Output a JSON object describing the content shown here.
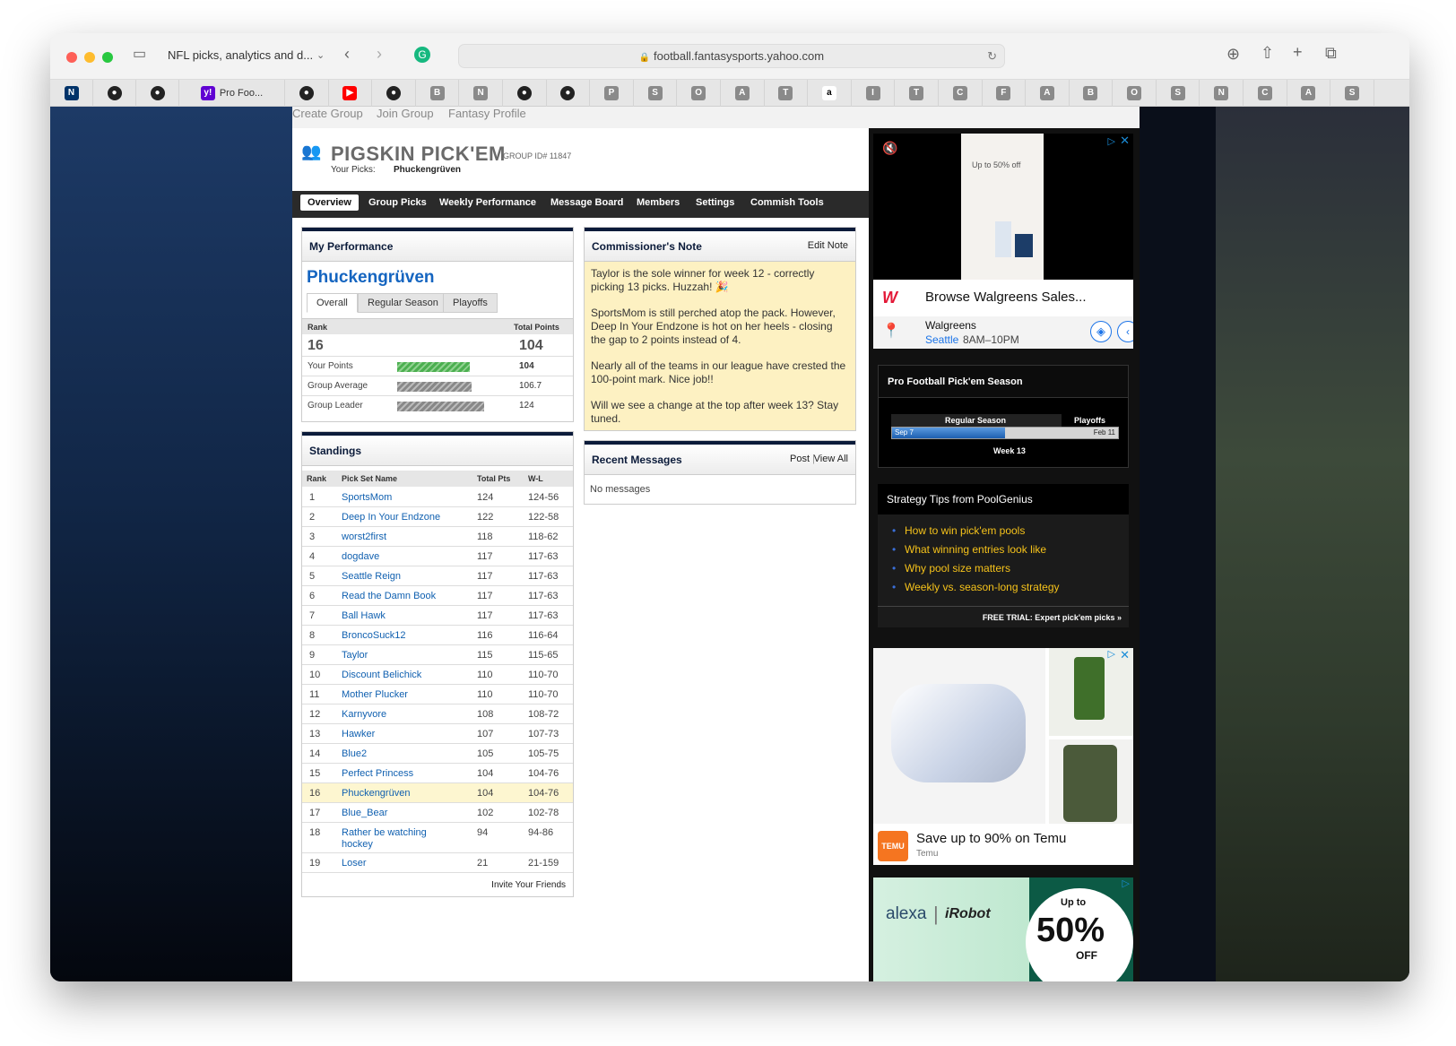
{
  "browser": {
    "tab_title": "NFL picks, analytics and d...",
    "url": "football.fantasysports.yahoo.com"
  },
  "favorites": [
    {
      "icon": "nfl-icon",
      "label": ""
    },
    {
      "icon": "github-icon",
      "label": ""
    },
    {
      "icon": "github-icon",
      "label": ""
    },
    {
      "icon": "yahoo-icon",
      "label": "Pro Foo..."
    },
    {
      "icon": "github-icon",
      "label": ""
    },
    {
      "icon": "youtube-icon",
      "label": ""
    },
    {
      "icon": "github-icon",
      "label": ""
    },
    {
      "letter": "B"
    },
    {
      "letter": "N"
    },
    {
      "icon": "medium-icon",
      "label": ""
    },
    {
      "icon": "medium-icon",
      "label": ""
    },
    {
      "letter": "P"
    },
    {
      "letter": "S"
    },
    {
      "letter": "O"
    },
    {
      "letter": "A"
    },
    {
      "letter": "T"
    },
    {
      "icon": "amazon-icon",
      "label": "a"
    },
    {
      "letter": "I"
    },
    {
      "letter": "T"
    },
    {
      "letter": "C"
    },
    {
      "letter": "F"
    },
    {
      "letter": "A"
    },
    {
      "letter": "B"
    },
    {
      "letter": "O"
    },
    {
      "letter": "S"
    },
    {
      "letter": "N"
    },
    {
      "letter": "C"
    },
    {
      "letter": "A"
    },
    {
      "letter": "S"
    }
  ],
  "toplinks": [
    "Create Group",
    "Join Group",
    "Fantasy Profile"
  ],
  "header": {
    "title": "PIGSKIN PICK'EM",
    "group_id": "GROUP ID# 11847",
    "your_picks_label": "Your Picks:",
    "your_picks_name": "Phuckengrüven"
  },
  "nav": [
    "Overview",
    "Group Picks",
    "Weekly Performance",
    "Message Board",
    "Members",
    "Settings",
    "Commish Tools"
  ],
  "performance": {
    "title": "My Performance",
    "name": "Phuckengrüven",
    "tabs": [
      "Overall",
      "Regular Season",
      "Playoffs"
    ],
    "rank_label": "Rank",
    "total_label": "Total Points",
    "rank": "16",
    "total": "104",
    "rows": [
      {
        "label": "Your Points",
        "value": "104",
        "fill": 0.81
      },
      {
        "label": "Group Average",
        "value": "106.7",
        "fill": 0.83
      },
      {
        "label": "Group Leader",
        "value": "124",
        "fill": 0.97
      }
    ]
  },
  "standings": {
    "title": "Standings",
    "headers": [
      "Rank",
      "Pick Set Name",
      "Total Pts",
      "W-L"
    ],
    "rows": [
      [
        "1",
        "SportsMom",
        "124",
        "124-56"
      ],
      [
        "2",
        "Deep In Your Endzone",
        "122",
        "122-58"
      ],
      [
        "3",
        "worst2first",
        "118",
        "118-62"
      ],
      [
        "4",
        "dogdave",
        "117",
        "117-63"
      ],
      [
        "5",
        "Seattle Reign",
        "117",
        "117-63"
      ],
      [
        "6",
        "Read the Damn Book",
        "117",
        "117-63"
      ],
      [
        "7",
        "Ball Hawk",
        "117",
        "117-63"
      ],
      [
        "8",
        "BroncoSuck12",
        "116",
        "116-64"
      ],
      [
        "9",
        "Taylor",
        "115",
        "115-65"
      ],
      [
        "10",
        "Discount Belichick",
        "110",
        "110-70"
      ],
      [
        "11",
        "Mother Plucker",
        "110",
        "110-70"
      ],
      [
        "12",
        "Karnyvore",
        "108",
        "108-72"
      ],
      [
        "13",
        "Hawker",
        "107",
        "107-73"
      ],
      [
        "14",
        "Blue2",
        "105",
        "105-75"
      ],
      [
        "15",
        "Perfect Princess",
        "104",
        "104-76"
      ],
      [
        "16",
        "Phuckengrüven",
        "104",
        "104-76"
      ],
      [
        "17",
        "Blue_Bear",
        "102",
        "102-78"
      ],
      [
        "18",
        "Rather be watching",
        "94",
        "94-86"
      ],
      [
        "19",
        "Loser",
        "21",
        "21-159"
      ]
    ],
    "row18_line2": "hockey",
    "invite": "Invite Your Friends"
  },
  "commish": {
    "title": "Commissioner's Note",
    "edit": "Edit Note",
    "paras": [
      "Taylor is the sole winner for week 12 - correctly picking 13 picks. Huzzah! 🎉",
      "SportsMom is still perched atop the pack. However, Deep In Your Endzone is hot on her heels - closing the gap to 2 points instead of 4.",
      "Nearly all of the teams in our league have crested the 100-point mark. Nice job!!",
      "Will we see a change at the top after week 13? Stay tuned."
    ]
  },
  "messages": {
    "title": "Recent Messages",
    "post": "Post",
    "view_all": "View All",
    "empty": "No messages"
  },
  "ad_walgreens": {
    "promo": "Up to 50% off",
    "headline": "Browse Walgreens Sales...",
    "brand": "Walgreens",
    "city": "Seattle",
    "hours": "8AM–10PM"
  },
  "season": {
    "title": "Pro Football Pick'em Season",
    "regular": "Regular Season",
    "playoffs": "Playoffs",
    "start": "Sep 7",
    "end": "Feb 11",
    "week": "Week 13",
    "progress": 0.5
  },
  "tips": {
    "title": "Strategy Tips from PoolGenius",
    "items": [
      "How to win pick'em pools",
      "What winning entries look like",
      "Why pool size matters",
      "Weekly vs. season-long strategy"
    ],
    "trial": "FREE TRIAL: Expert pick'em picks »"
  },
  "ad_temu": {
    "headline": "Save up to 90% on Temu",
    "brand": "Temu",
    "logo": "TEMU"
  },
  "ad_alexa": {
    "alexa": "alexa",
    "robot": "iRobot",
    "upto": "Up to",
    "pct": "50%",
    "off": "OFF"
  }
}
